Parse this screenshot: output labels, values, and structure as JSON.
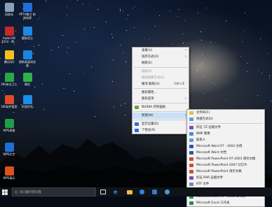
{
  "desktop_icons": [
    {
      "label": "回收站",
      "color": "#8aa0b8"
    },
    {
      "label": "PPTV聚力 网络电视",
      "color": "#1e6fd9"
    },
    {
      "label": "AutoCAD 2014 - 简...",
      "color": "#c62828"
    },
    {
      "label": "酷狗音乐",
      "color": "#1e88e5"
    },
    {
      "label": "腾讯QQ",
      "color": "#f2c21b"
    },
    {
      "label": "搜狗高速浏览器",
      "color": "#1b84e0"
    },
    {
      "label": "360安全卫士",
      "color": "#27a844"
    },
    {
      "label": "微信",
      "color": "#2fb24b"
    },
    {
      "label": "360软件管家",
      "color": "#e04a2a"
    },
    {
      "label": "阿里旺旺",
      "color": "#1a8fe6"
    },
    {
      "label": "WPS表格",
      "color": "#1f9e4a"
    },
    {
      "label": "WPS文字",
      "color": "#1f6fd8"
    },
    {
      "label": "WPS演示",
      "color": "#d9531e"
    }
  ],
  "context_menu": {
    "items": [
      {
        "label": "查看(V)",
        "submenu": true
      },
      {
        "label": "排序方式(O)",
        "submenu": true
      },
      {
        "label": "刷新(E)"
      },
      {
        "sep": true
      },
      {
        "label": "粘贴(P)",
        "disabled": true
      },
      {
        "label": "粘贴快捷方式(S)",
        "disabled": true
      },
      {
        "label": "撤消 删除(U)",
        "shortcut": "Ctrl+Z"
      },
      {
        "sep": true
      },
      {
        "label": "图形属性..."
      },
      {
        "label": "图形选项",
        "submenu": true
      },
      {
        "sep": true
      },
      {
        "label": "NVIDIA 控制面板",
        "icon": "#6aa629"
      },
      {
        "sep": true
      },
      {
        "label": "新建(W)",
        "submenu": true,
        "highlighted": true
      },
      {
        "sep": true
      },
      {
        "label": "显示设置(D)",
        "icon": "#2a6fd0"
      },
      {
        "label": "个性化(R)",
        "icon": "#2a6fd0"
      }
    ]
  },
  "new_submenu": {
    "items": [
      {
        "label": "文件夹(F)",
        "icon": "#e8bd4a"
      },
      {
        "label": "快捷方式(S)",
        "icon": "#5aa0e0"
      },
      {
        "sep": true
      },
      {
        "label": "好压 7Z 压缩文件",
        "icon": "#7a4fb8"
      },
      {
        "label": "BMP 图像",
        "icon": "#4a8ad8"
      },
      {
        "label": "联系人",
        "icon": "#5a9ad0"
      },
      {
        "label": "Microsoft Word 97 - 2003 文档",
        "icon": "#2b5aa8"
      },
      {
        "label": "Microsoft Word 文档",
        "icon": "#2b5aa8"
      },
      {
        "label": "Microsoft PowerPoint 97-2003 演示文稿",
        "icon": "#c9502a"
      },
      {
        "label": "Microsoft PowerPoint 2007 幻灯片",
        "icon": "#c9502a"
      },
      {
        "label": "Microsoft PowerPoint 演示文稿",
        "icon": "#c9502a"
      },
      {
        "label": "好压 RAR 压缩文件",
        "icon": "#7a4fb8"
      },
      {
        "label": "RTF 文件",
        "icon": "#6a8ab8"
      },
      {
        "label": "文本文档",
        "icon": "#8a8a8a",
        "highlighted": true
      },
      {
        "label": "Microsoft Excel 97 - 2003 工作表",
        "icon": "#2a8a4a"
      },
      {
        "label": "Microsoft Excel 工作表",
        "icon": "#2a8a4a"
      }
    ]
  },
  "taskbar": {
    "search_placeholder": "有问题尽管问我",
    "start_icon": "windows-logo-icon",
    "pinned": [
      "task-view-icon",
      "edge-icon",
      "file-explorer-icon",
      "browser-icon",
      "app-icon",
      "media-icon"
    ]
  }
}
